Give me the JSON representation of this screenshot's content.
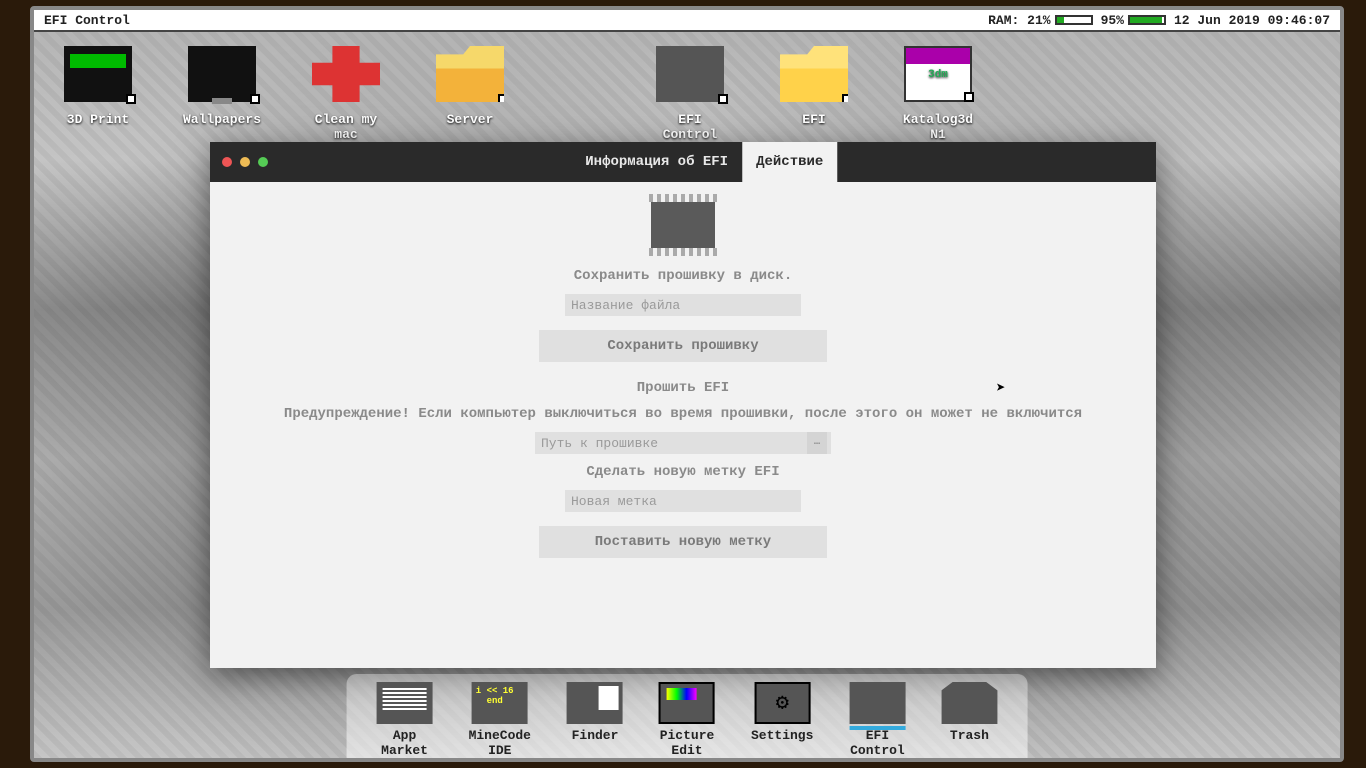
{
  "menubar": {
    "app_title": "EFI Control",
    "ram_label": "RAM:",
    "ram_pct": "21%",
    "bat_pct": "95%",
    "datetime": "12 Jun 2019 09:46:07"
  },
  "desktop_icons": [
    {
      "label": "3D Print",
      "kind": "printer"
    },
    {
      "label": "Wallpapers",
      "kind": "monitor"
    },
    {
      "label": "Clean my mac",
      "kind": "clean"
    },
    {
      "label": "Server",
      "kind": "folder"
    },
    {
      "label": "",
      "kind": "spacer"
    },
    {
      "label": "EFI Control",
      "kind": "chip"
    },
    {
      "label": "EFI",
      "kind": "folder yel"
    },
    {
      "label": "Katalog3d N1",
      "kind": "doc"
    }
  ],
  "window": {
    "tabs": {
      "info": "Информация об EFI",
      "action": "Действие",
      "active": "action"
    },
    "save_section_label": "Сохранить прошивку в диск.",
    "filename_placeholder": "Название файла",
    "save_button": "Сохранить прошивку",
    "flash_section_label": "Прошить EFI",
    "warning": "Предупреждение! Если компьютер выключиться во время прошивки, после этого он может не включится",
    "path_placeholder": "Путь к прошивке",
    "browse_dots": "…",
    "newlabel_section": "Сделать новую метку EFI",
    "newlabel_placeholder": "Новая метка",
    "setlabel_button": "Поставить новую метку"
  },
  "dock": [
    {
      "label": "App Market",
      "kind": "market"
    },
    {
      "label": "MineCode IDE",
      "kind": "ide"
    },
    {
      "label": "Finder",
      "kind": "finder"
    },
    {
      "label": "Picture Edit",
      "kind": "pic"
    },
    {
      "label": "Settings",
      "kind": "set"
    },
    {
      "label": "EFI Control",
      "kind": "efi"
    },
    {
      "label": "Trash",
      "kind": "trash"
    }
  ]
}
